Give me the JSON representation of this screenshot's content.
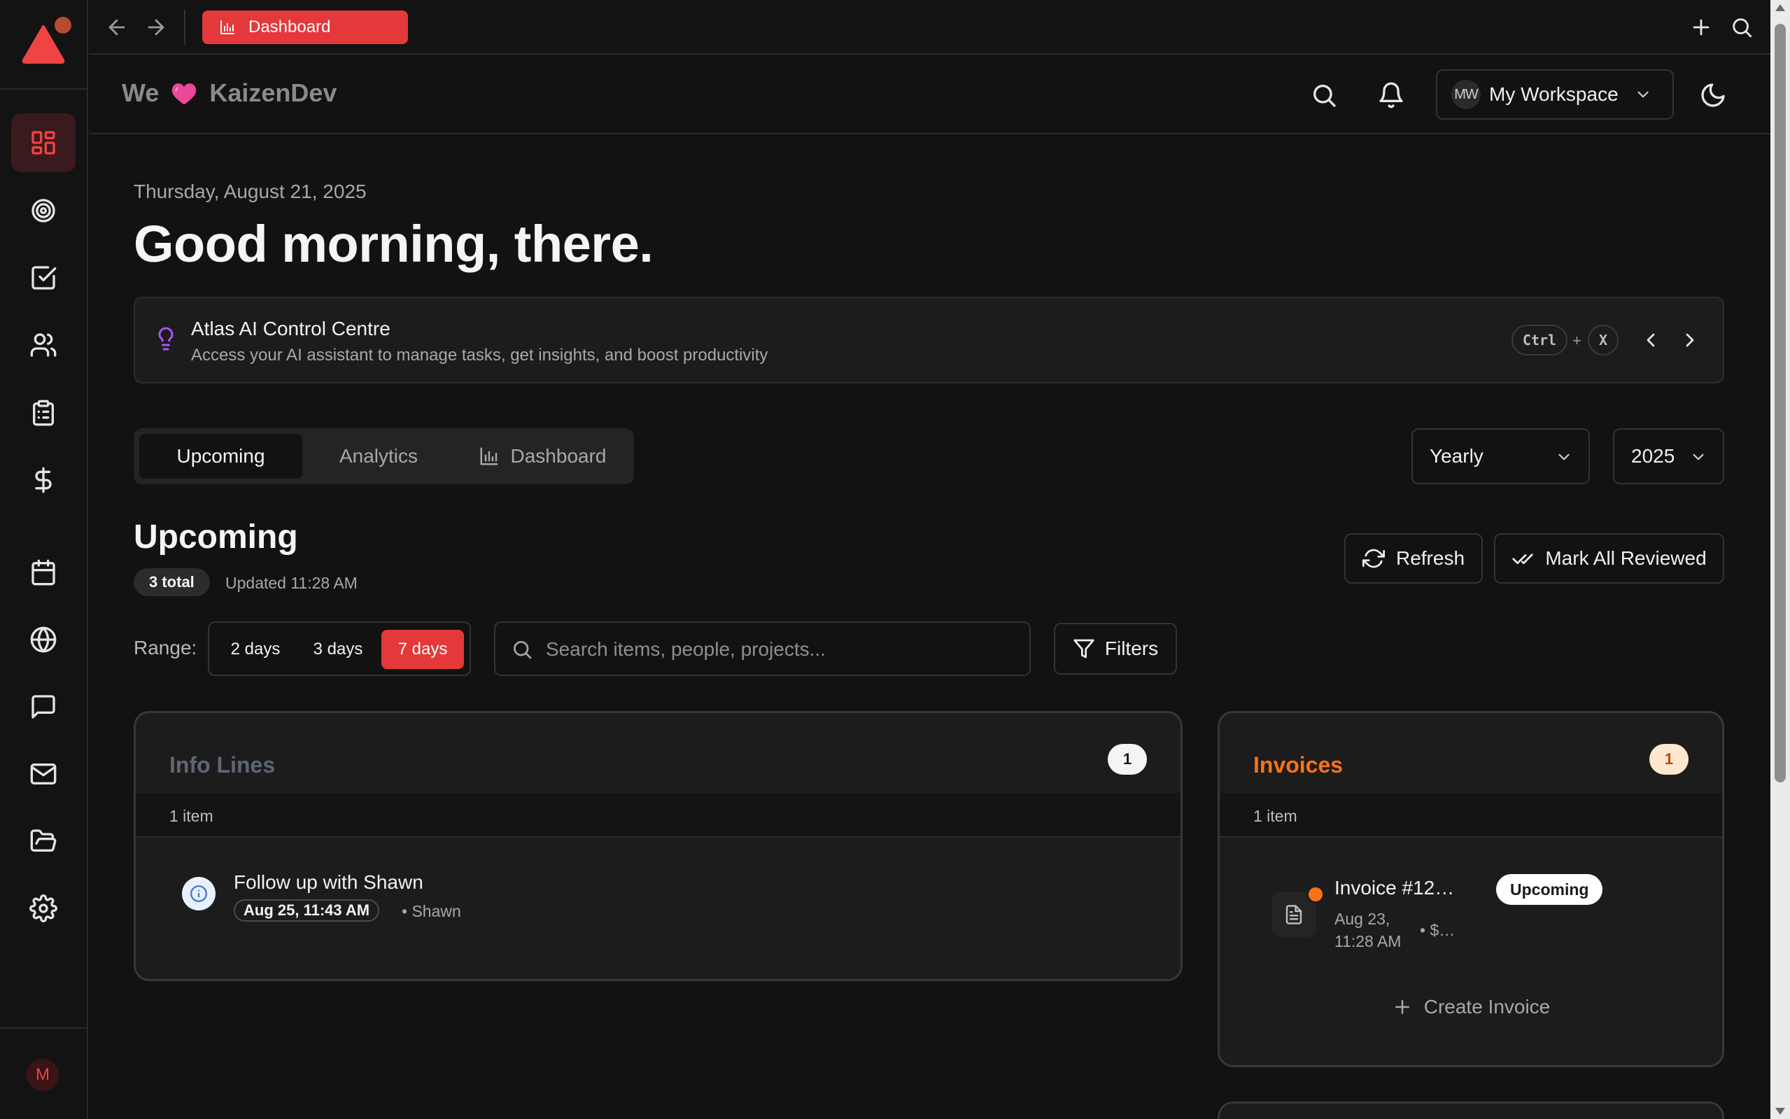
{
  "topbar": {
    "active_tab": "Dashboard"
  },
  "header": {
    "brand_we": "We",
    "brand_name": "KaizenDev",
    "workspace_initials": "MW",
    "workspace_name": "My Workspace"
  },
  "sidebar": {
    "items": [
      {
        "icon": "dashboard-icon",
        "active": true
      },
      {
        "icon": "target-icon"
      },
      {
        "icon": "checkbox-icon"
      },
      {
        "icon": "users-icon"
      },
      {
        "icon": "clipboard-icon"
      },
      {
        "icon": "dollar-icon"
      },
      {
        "icon": "calendar-icon"
      },
      {
        "icon": "globe-icon"
      },
      {
        "icon": "chat-icon"
      },
      {
        "icon": "mail-icon"
      },
      {
        "icon": "folder-icon"
      },
      {
        "icon": "settings-icon"
      }
    ],
    "user_initial": "M"
  },
  "main": {
    "date": "Thursday, August 21, 2025",
    "greeting": "Good morning, there.",
    "atlas": {
      "title": "Atlas AI Control Centre",
      "subtitle": "Access your AI assistant to manage tasks, get insights, and boost productivity",
      "key1": "Ctrl",
      "plus": "+",
      "key2": "X"
    },
    "tabs": [
      {
        "label": "Upcoming",
        "active": true
      },
      {
        "label": "Analytics"
      },
      {
        "label": "Dashboard"
      }
    ],
    "period_select": "Yearly",
    "year_select": "2025",
    "section_title": "Upcoming",
    "total_badge": "3 total",
    "updated": "Updated 11:28 AM",
    "refresh_label": "Refresh",
    "mark_all_label": "Mark All Reviewed",
    "range_label": "Range:",
    "range_options": [
      {
        "label": "2 days"
      },
      {
        "label": "3 days"
      },
      {
        "label": "7 days",
        "active": true
      }
    ],
    "search_placeholder": "Search items, people, projects...",
    "filters_label": "Filters"
  },
  "cards": {
    "info_lines": {
      "title": "Info Lines",
      "count": "1",
      "subheader": "1 item",
      "item": {
        "title": "Follow up with Shawn",
        "date": "Aug 25, 11:43 AM",
        "person": "• Shawn"
      }
    },
    "invoices": {
      "title": "Invoices",
      "count": "1",
      "subheader": "1 item",
      "item": {
        "title": "Invoice #12…",
        "status": "Upcoming",
        "date_line1": "Aug 23,",
        "date_line2": "11:28 AM",
        "amount": "• $…"
      },
      "create_label": "Create Invoice"
    }
  },
  "colors": {
    "accent": "#e5383b",
    "invoices_title": "#f97316",
    "info_title": "#5f6675",
    "atlas_icon": "#a855f7"
  }
}
